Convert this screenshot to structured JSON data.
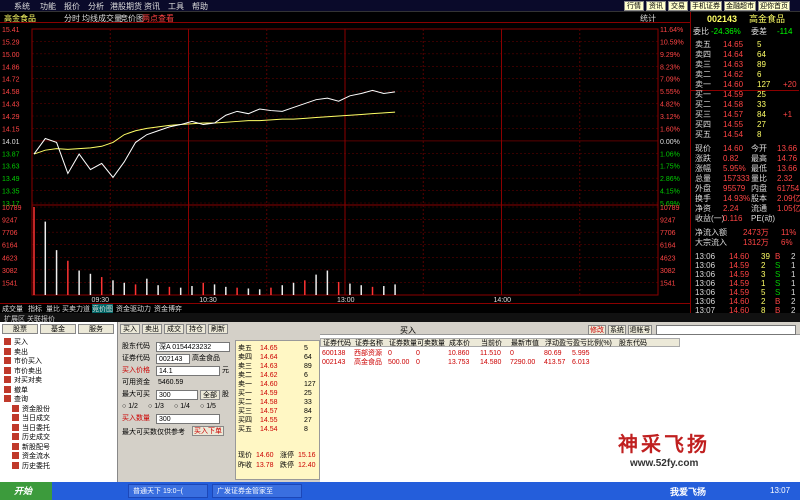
{
  "menu": [
    "系统",
    "功能",
    "报价",
    "分析",
    "港股期货",
    "资讯",
    "工具",
    "帮助"
  ],
  "top_buttons": [
    "行情",
    "资讯",
    "交易",
    "手机证券",
    "金融超市",
    "迎你首页"
  ],
  "chart_header": {
    "name": "高金食品",
    "labels": [
      "分时",
      "均线",
      "成交量",
      "竞价图"
    ],
    "tip": "两点查看",
    "right": "统计"
  },
  "chart_data": {
    "type": "line",
    "price_ticks": [
      "15.41",
      "15.29",
      "15.00",
      "14.86",
      "14.72",
      "14.58",
      "14.43",
      "14.29",
      "14.15",
      "14.01",
      "13.87",
      "13.63",
      "13.49",
      "13.35",
      "13.17"
    ],
    "pct_ticks": [
      "11.64%",
      "10.59%",
      "9.29%",
      "8.23%",
      "7.09%",
      "5.55%",
      "4.82%",
      "3.12%",
      "1.60%",
      "0.00%",
      "1.06%",
      "1.75%",
      "2.86%",
      "4.15%",
      "5.69%"
    ],
    "vol_ticks": [
      "10789",
      "9247",
      "7706",
      "6164",
      "4623",
      "3082",
      "1541"
    ],
    "time_labels": [
      "09:30",
      "10:30",
      "13:00",
      "14:00"
    ],
    "price_range": [
      13.17,
      15.41
    ],
    "price": [
      13.8,
      14.0,
      13.95,
      13.55,
      13.8,
      13.6,
      13.68,
      13.5,
      13.7,
      13.95,
      14.05,
      14.1,
      14.15,
      14.18,
      14.22,
      14.18,
      14.2,
      14.3,
      14.35,
      14.32,
      14.38,
      14.36,
      14.35,
      14.4,
      14.45,
      14.5,
      14.52,
      14.48,
      14.55,
      14.58,
      14.62,
      14.58,
      14.6
    ],
    "avg": [
      13.8,
      13.85,
      13.87,
      13.86,
      13.87,
      13.88,
      13.9,
      13.95,
      14.05,
      14.1,
      14.13,
      14.15,
      14.17,
      14.18,
      14.19,
      14.2,
      14.2,
      14.21,
      14.22,
      14.23,
      14.23,
      14.24,
      14.25,
      14.25,
      14.26,
      14.27,
      14.28,
      14.29,
      14.3,
      14.31,
      14.32,
      14.33,
      14.34
    ],
    "volume": [
      10789,
      9000,
      5500,
      4200,
      3000,
      2600,
      2200,
      1800,
      1500,
      1300,
      2000,
      1200,
      1000,
      900,
      1100,
      1500,
      1300,
      1000,
      900,
      800,
      700,
      900,
      1200,
      1500,
      1800,
      2500,
      3000,
      1600,
      1400,
      1200,
      1000,
      1100,
      1300
    ]
  },
  "stock": {
    "code": "002143",
    "name": "高金食品",
    "wb_label": "委比",
    "wb": "-24.36%",
    "wc_label": "委差",
    "wc": "-114"
  },
  "orderbook": [
    {
      "l": "卖五",
      "p": "14.65",
      "v": "5"
    },
    {
      "l": "卖四",
      "p": "14.64",
      "v": "64"
    },
    {
      "l": "卖三",
      "p": "14.63",
      "v": "89"
    },
    {
      "l": "卖二",
      "p": "14.62",
      "v": "6"
    },
    {
      "l": "卖一",
      "p": "14.60",
      "v": "127",
      "c": "+20"
    },
    {
      "l": "买一",
      "p": "14.59",
      "v": "25"
    },
    {
      "l": "买二",
      "p": "14.58",
      "v": "33"
    },
    {
      "l": "买三",
      "p": "14.57",
      "v": "84",
      "c": "+1"
    },
    {
      "l": "买四",
      "p": "14.55",
      "v": "27"
    },
    {
      "l": "买五",
      "p": "14.54",
      "v": "8"
    }
  ],
  "stats": [
    {
      "a": "现价",
      "b": "14.60",
      "c": "今开",
      "d": "13.66"
    },
    {
      "a": "涨跌",
      "b": "0.82",
      "c": "最高",
      "d": "14.76"
    },
    {
      "a": "涨幅",
      "b": "5.95%",
      "c": "最低",
      "d": "13.66"
    },
    {
      "a": "总量",
      "b": "157333",
      "c": "量比",
      "d": "2.32"
    },
    {
      "a": "外盘",
      "b": "95579",
      "c": "内盘",
      "d": "61754"
    },
    {
      "a": "换手",
      "b": "14.93%",
      "c": "股本",
      "d": "2.09亿"
    },
    {
      "a": "净资",
      "b": "2.24",
      "c": "流通",
      "d": "1.05亿"
    },
    {
      "a": "收益(一)",
      "b": "0.116",
      "c": "PE(动)",
      "d": ""
    }
  ],
  "flows": [
    {
      "a": "净流入额",
      "b": "2473万",
      "c": "11%"
    },
    {
      "a": "大宗流入",
      "b": "1312万",
      "c": "6%"
    }
  ],
  "ticks": [
    {
      "t": "13:06",
      "p": "14.60",
      "v": "39",
      "f": "B",
      "n": "2"
    },
    {
      "t": "13:06",
      "p": "14.59",
      "v": "2",
      "f": "S",
      "n": "1"
    },
    {
      "t": "13:06",
      "p": "14.59",
      "v": "3",
      "f": "S",
      "n": "1"
    },
    {
      "t": "13:06",
      "p": "14.59",
      "v": "1",
      "f": "S",
      "n": "1"
    },
    {
      "t": "13:06",
      "p": "14.59",
      "v": "5",
      "f": "S",
      "n": "1"
    },
    {
      "t": "13:06",
      "p": "14.60",
      "v": "2",
      "f": "B",
      "n": "2"
    },
    {
      "t": "13:07",
      "p": "14.60",
      "v": "8",
      "f": "B",
      "n": "2"
    }
  ],
  "bottom_tabs": [
    "成交量",
    "指标",
    "量比",
    "买卖力道",
    "竞价图",
    "资金驱动力",
    "资金博弈"
  ],
  "ext_label": "扩展区  关联报价",
  "nav": {
    "tabs": [
      "股票",
      "基金",
      "服务"
    ],
    "items": [
      "买入",
      "卖出",
      "市价买入",
      "市价卖出",
      "对买对卖",
      "撤单",
      "查询",
      "资金股份",
      "当日成交",
      "当日委托",
      "历史成交",
      "新股配号",
      "资金流水",
      "历史委托"
    ]
  },
  "trade_tabs": [
    "买入",
    "卖出",
    "成交",
    "持仓",
    "刷新"
  ],
  "form": {
    "acct_label": "股东代码",
    "acct": "深A 0154423232",
    "code_label": "证券代码",
    "code": "002143",
    "code_name": "高金食品",
    "price_label": "买入价格",
    "price": "14.1",
    "unit": "元",
    "avail_label": "可用资金",
    "avail": "5460.59",
    "max_label": "最大可买",
    "max": "300",
    "all_btn": "全部",
    "lot": "股",
    "fractions": [
      "1/2",
      "1/3",
      "1/4",
      "1/5"
    ],
    "qty_label": "买入数量",
    "qty": "300",
    "hint": "最大可买数仅供参考",
    "submit": "买入下单"
  },
  "quote": {
    "rows": [
      {
        "l": "卖五",
        "p": "14.65",
        "v": "5"
      },
      {
        "l": "卖四",
        "p": "14.64",
        "v": "64"
      },
      {
        "l": "卖三",
        "p": "14.63",
        "v": "89"
      },
      {
        "l": "卖二",
        "p": "14.62",
        "v": "6"
      },
      {
        "l": "卖一",
        "p": "14.60",
        "v": "127"
      },
      {
        "l": "买一",
        "p": "14.59",
        "v": "25"
      },
      {
        "l": "买二",
        "p": "14.58",
        "v": "33"
      },
      {
        "l": "买三",
        "p": "14.57",
        "v": "84"
      },
      {
        "l": "买四",
        "p": "14.55",
        "v": "27"
      },
      {
        "l": "买五",
        "p": "14.54",
        "v": "8"
      }
    ],
    "foot": [
      {
        "a": "现价",
        "b": "14.60",
        "c": "涨停",
        "d": "15.16"
      },
      {
        "a": "昨收",
        "b": "13.78",
        "c": "跌停",
        "d": "12.40"
      }
    ]
  },
  "holdings": {
    "title": "买入",
    "buttons": [
      "修改",
      "系统",
      "退帐号"
    ],
    "headers": [
      "证券代码",
      "证券名称",
      "证券数量",
      "可卖数量",
      "成本价",
      "当前价",
      "最新市值",
      "浮动盈亏",
      "盈亏比例(%)",
      "股东代码"
    ],
    "rows": [
      [
        "600138",
        "西部资源",
        "0",
        "0",
        "10.860",
        "11.510",
        "0",
        "80.69",
        "5.995"
      ],
      [
        "002143",
        "高金食品",
        "500.00",
        "0",
        "13.753",
        "14.580",
        "7290.00",
        "413.57",
        "6.013"
      ]
    ]
  },
  "watermark": {
    "title": "神采飞扬",
    "url": "www.52fy.com",
    "bottom": "我爱飞扬"
  },
  "taskbar": {
    "start": "开始",
    "tasks": [
      "普通天下 19:0~(",
      "广发证券金管家至"
    ],
    "clock": "13:07"
  }
}
